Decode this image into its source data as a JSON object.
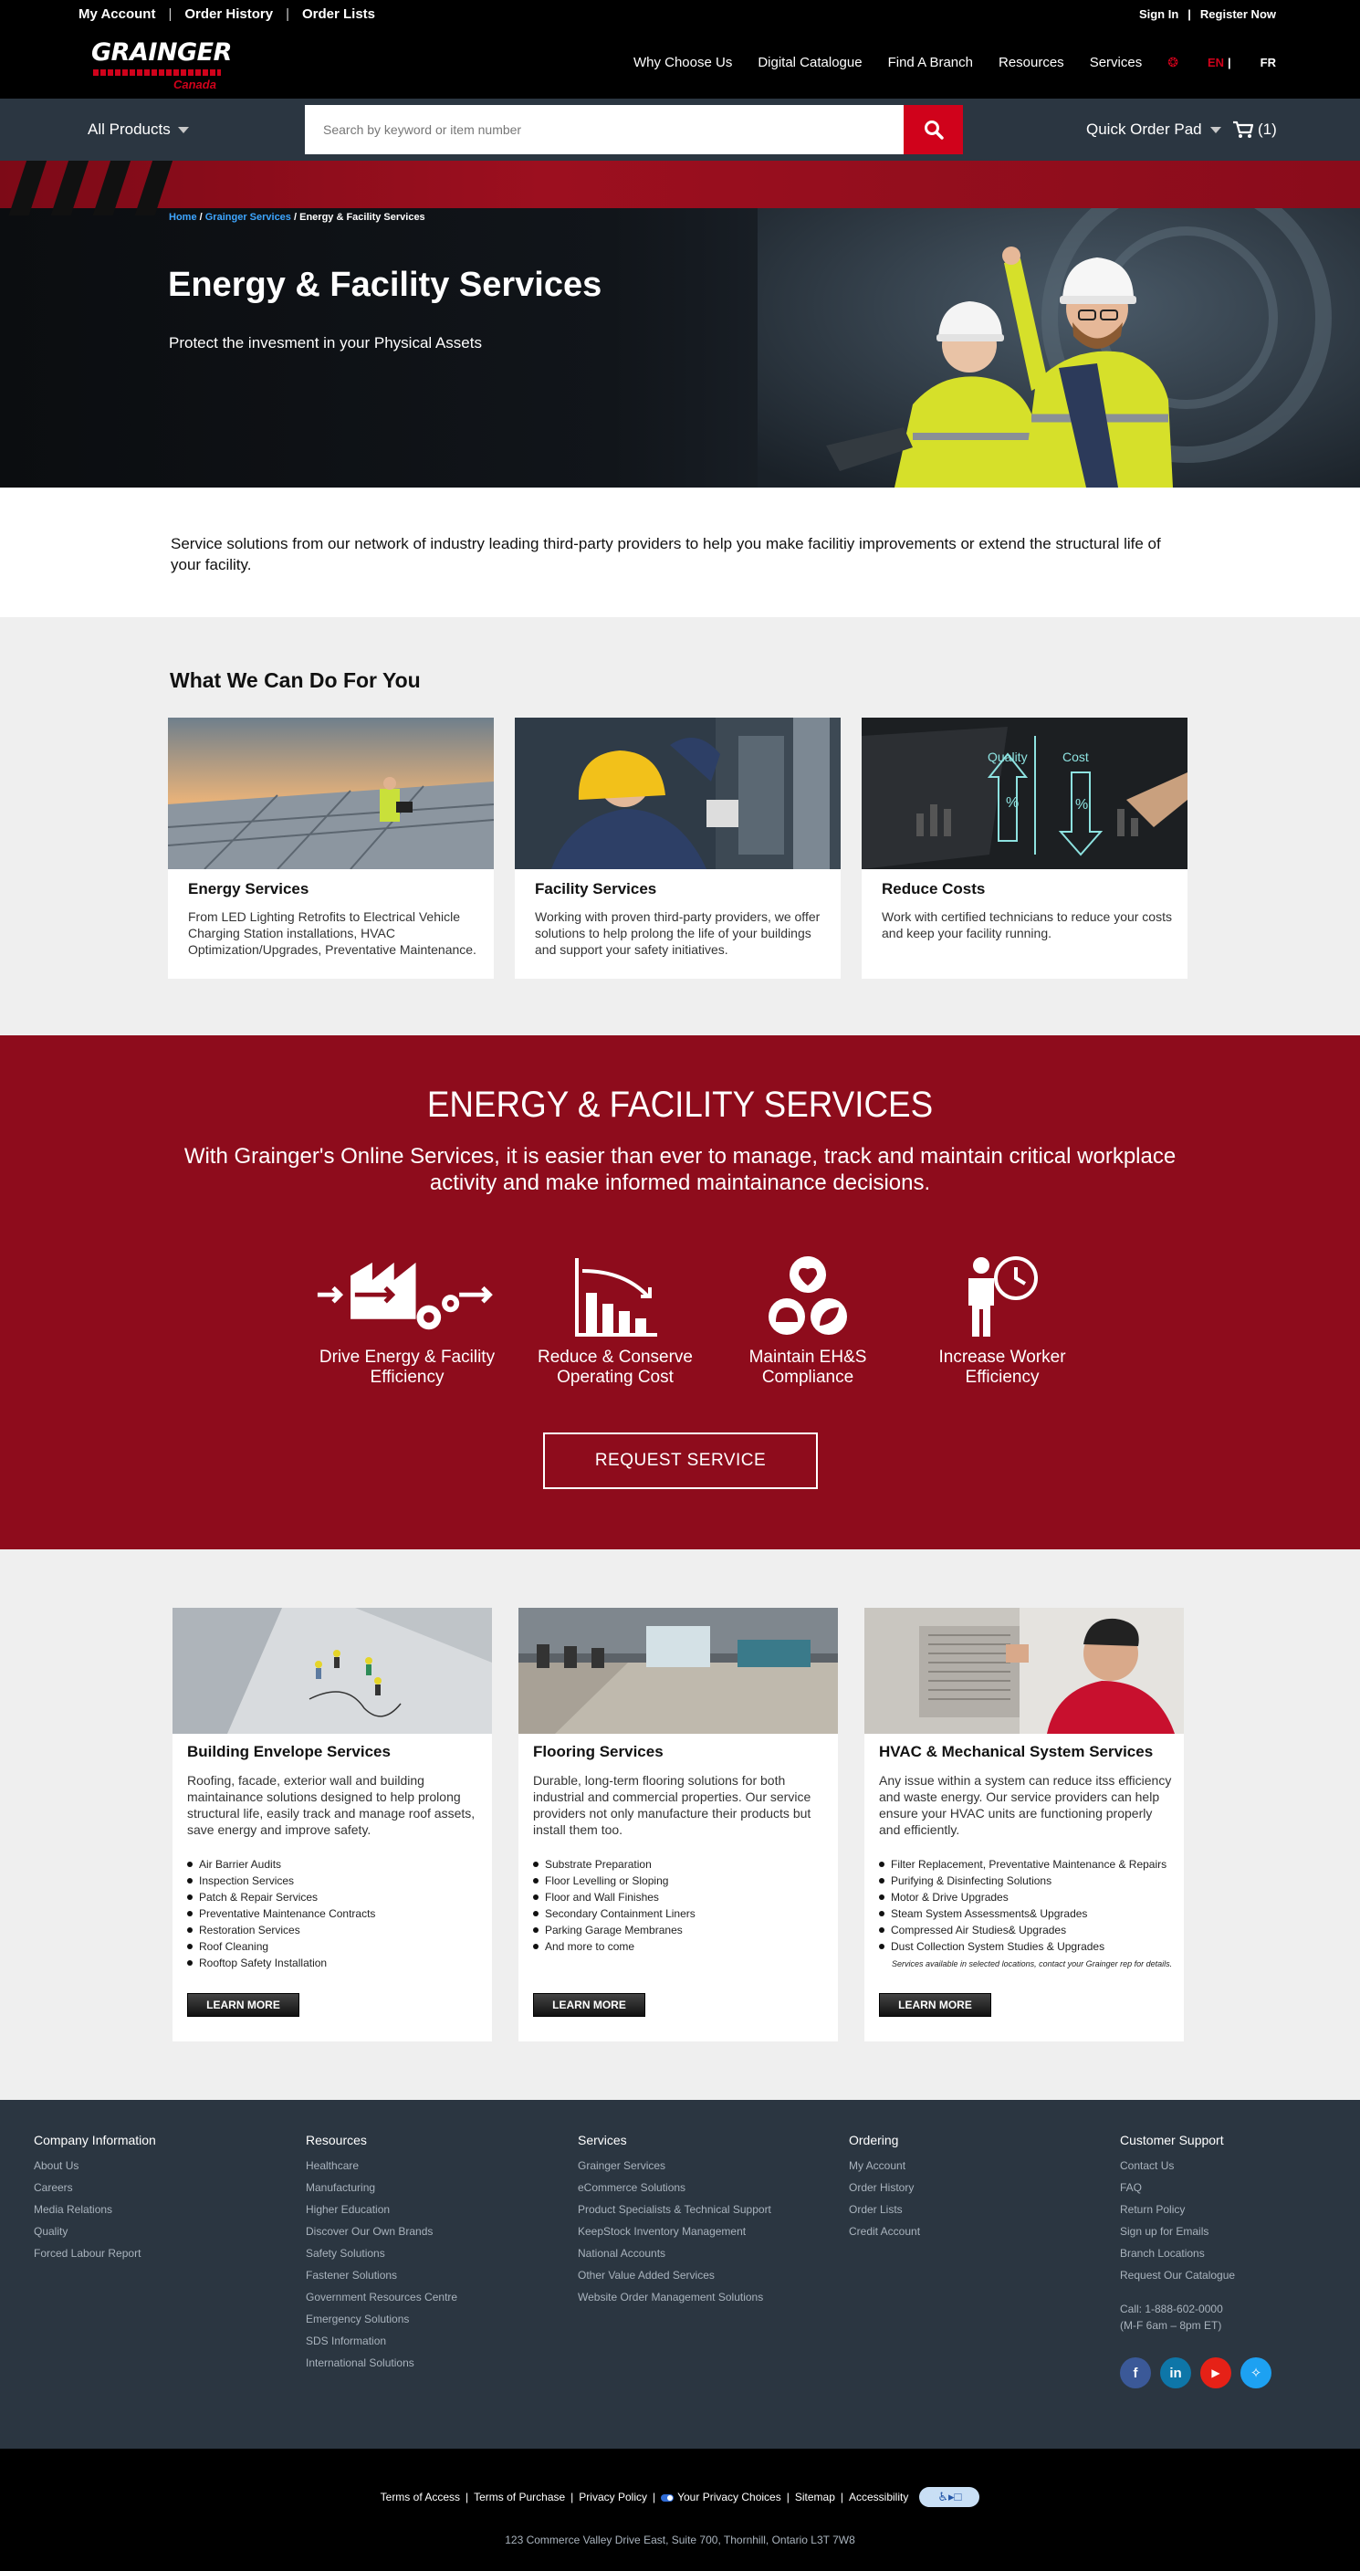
{
  "topbar": {
    "links": [
      "My Account",
      "Order History",
      "Order Lists"
    ],
    "sign_in": "Sign In",
    "register": "Register Now"
  },
  "header": {
    "logo_text": "GRAINGER",
    "logo_sub": "Canada",
    "nav": [
      "Why Choose Us",
      "Digital Catalogue",
      "Find A Branch",
      "Resources",
      "Services"
    ],
    "lang_en": "EN",
    "lang_fr": "FR"
  },
  "searchbar": {
    "all_products": "All Products",
    "placeholder": "Search by keyword or item number",
    "quick_order": "Quick Order Pad",
    "cart_count": "(1)"
  },
  "hero": {
    "breadcrumb": [
      "Home",
      "Grainger Services",
      "Energy & Facility Services"
    ],
    "title": "Energy & Facility Services",
    "subtitle": "Protect the invesment in your Physical Assets"
  },
  "intro": {
    "text": "Service solutions from our network of industry leading third-party providers to help you make facilitiy improvements or extend the structural life of your facility."
  },
  "what_we_do": {
    "heading": "What We Can Do For You",
    "cards": [
      {
        "title": "Energy Services",
        "text": "From LED Lighting Retrofits to Electrical Vehicle Charging Station installations, HVAC Optimization/Upgrades, Preventative Maintenance."
      },
      {
        "title": "Facility Services",
        "text": "Working with proven third-party providers, we offer solutions to help prolong the life of your buildings and support your safety initiatives."
      },
      {
        "title": "Reduce Costs",
        "text": "Work with certified technicians to reduce your costs and keep your facility running.",
        "img_labels": [
          "Quality",
          "Cost"
        ]
      }
    ]
  },
  "promo": {
    "heading": "ENERGY & FACILITY SERVICES",
    "lead": "With Grainger's Online Services, it is easier than ever to manage, track and maintain critical workplace activity and make informed maintainance decisions.",
    "benefits": [
      {
        "label": "Drive Energy & Facility Efficiency",
        "icon": "factory-gears-icon"
      },
      {
        "label": "Reduce & Conserve Operating Cost",
        "icon": "declining-bar-chart-icon"
      },
      {
        "label": "Maintain EH&S Compliance",
        "icon": "health-safety-environment-icon"
      },
      {
        "label": "Increase Worker Efficiency",
        "icon": "worker-clock-icon"
      }
    ],
    "button": "REQUEST SERVICE"
  },
  "services": [
    {
      "title": "Building Envelope Services",
      "desc": "Roofing, facade, exterior wall and building maintainance solutions designed to help prolong structural life, easily track and manage roof assets, save energy and improve safety.",
      "items": [
        "Air Barrier Audits",
        "Inspection Services",
        "Patch & Repair Services",
        "Preventative Maintenance Contracts",
        "Restoration Services",
        "Roof Cleaning",
        "Rooftop Safety Installation"
      ],
      "button": "LEARN MORE"
    },
    {
      "title": "Flooring Services",
      "desc": "Durable, long-term flooring solutions for both industrial and commercial properties. Our service providers not only manufacture their products but install them too.",
      "items": [
        "Substrate Preparation",
        "Floor Levelling or Sloping",
        "Floor and Wall Finishes",
        "Secondary Containment Liners",
        "Parking Garage Membranes",
        "And more to come"
      ],
      "button": "LEARN MORE"
    },
    {
      "title": "HVAC & Mechanical System Services",
      "desc": "Any issue within a system can reduce itss efficiency and waste energy. Our service providers can help ensure your HVAC units are functioning properly and efficiently.",
      "items": [
        "Filter Replacement, Preventative Maintenance & Repairs",
        "Purifying & Disinfecting Solutions",
        "Motor & Drive Upgrades",
        "Steam System Assessments& Upgrades",
        "Compressed Air Studies& Upgrades",
        "Dust Collection System Studies & Upgrades"
      ],
      "note": "Services available in selected locations, contact your Grainger rep for details.",
      "button": "LEARN MORE"
    }
  ],
  "footer": {
    "columns": [
      {
        "heading": "Company Information",
        "links": [
          "About Us",
          "Careers",
          "Media Relations",
          "Quality",
          "Forced Labour Report"
        ]
      },
      {
        "heading": "Resources",
        "links": [
          "Healthcare",
          "Manufacturing",
          "Higher Education",
          "Discover Our Own Brands",
          "Safety Solutions",
          "Fastener Solutions",
          "Government Resources Centre",
          "Emergency Solutions",
          "SDS Information",
          "International Solutions"
        ]
      },
      {
        "heading": "Services",
        "links": [
          "Grainger Services",
          "eCommerce Solutions",
          "Product Specialists & Technical Support",
          "KeepStock Inventory Management",
          "National Accounts",
          "Other Value Added Services",
          "Website Order Management Solutions"
        ]
      },
      {
        "heading": "Ordering",
        "links": [
          "My Account",
          "Order History",
          "Order Lists",
          "Credit Account"
        ]
      },
      {
        "heading": "Customer Support",
        "links": [
          "Contact Us",
          "FAQ",
          "Return Policy",
          "Sign up for Emails",
          "Branch Locations",
          "Request Our Catalogue"
        ]
      }
    ],
    "phone": "Call: 1-888-602-0000",
    "hours": "(M-F 6am – 8pm ET)",
    "socials": [
      {
        "name": "facebook-icon",
        "glyph": "f",
        "color": "#3b5998"
      },
      {
        "name": "linkedin-icon",
        "glyph": "in",
        "color": "#0e76a8"
      },
      {
        "name": "youtube-icon",
        "glyph": "▶",
        "color": "#e62117"
      },
      {
        "name": "twitter-icon",
        "glyph": "✧",
        "color": "#1da1f2"
      }
    ]
  },
  "bottom": {
    "links": [
      "Terms of Access",
      "Terms of Purchase",
      "Privacy Policy",
      "Your Privacy Choices",
      "Sitemap",
      "Accessibility"
    ],
    "address": "123 Commerce Valley Drive East, Suite 700, Thornhill, Ontario L3T 7W8"
  }
}
